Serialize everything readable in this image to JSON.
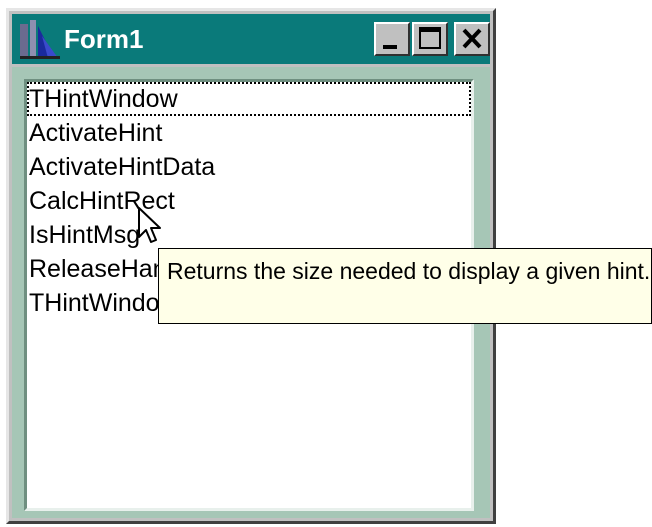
{
  "window": {
    "title": "Form1",
    "buttons": {
      "minimize": "minimize",
      "maximize": "maximize",
      "close": "close"
    }
  },
  "listbox": {
    "items": [
      "THintWindow",
      "ActivateHint",
      "ActivateHintData",
      "CalcHintRect",
      "IsHintMsg",
      "ReleaseHandle",
      "THintWindow"
    ],
    "focused_index": 0
  },
  "tooltip": {
    "text": "Returns the size needed to display a given hint."
  },
  "colors": {
    "titlebar": "#0a7a7a",
    "client": "#a6c6b6",
    "tooltip_bg": "#ffffe8"
  }
}
